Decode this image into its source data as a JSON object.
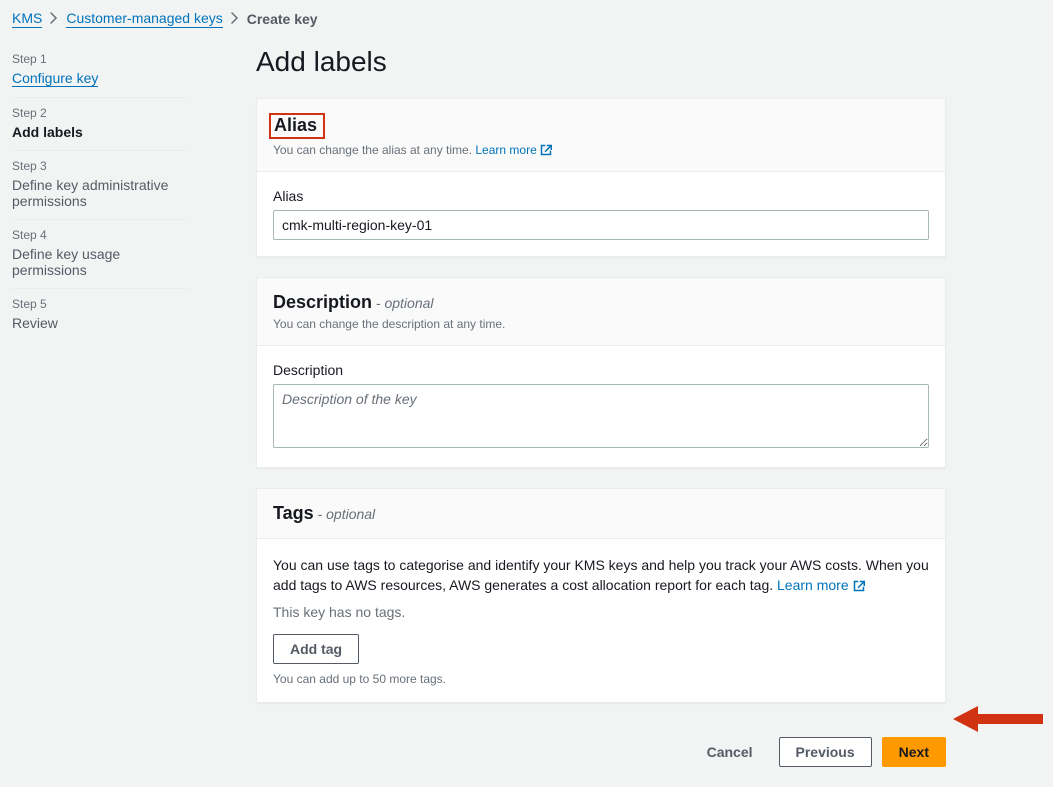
{
  "breadcrumb": {
    "root": "KMS",
    "mid": "Customer-managed keys",
    "current": "Create key"
  },
  "sidebar": {
    "steps": [
      {
        "label": "Step 1",
        "title": "Configure key",
        "kind": "link"
      },
      {
        "label": "Step 2",
        "title": "Add labels",
        "kind": "active"
      },
      {
        "label": "Step 3",
        "title": "Define key administrative permissions",
        "kind": "normal"
      },
      {
        "label": "Step 4",
        "title": "Define key usage permissions",
        "kind": "normal"
      },
      {
        "label": "Step 5",
        "title": "Review",
        "kind": "normal"
      }
    ]
  },
  "page": {
    "title": "Add labels"
  },
  "alias": {
    "heading": "Alias",
    "subtext": "You can change the alias at any time.",
    "learn": "Learn more",
    "field_label": "Alias",
    "value": "cmk-multi-region-key-01"
  },
  "description": {
    "heading": "Description",
    "optional": "- optional",
    "subtext": "You can change the description at any time.",
    "field_label": "Description",
    "placeholder": "Description of the key"
  },
  "tags": {
    "heading": "Tags",
    "optional": "- optional",
    "text": "You can use tags to categorise and identify your KMS keys and help you track your AWS costs. When you add tags to AWS resources, AWS generates a cost allocation report for each tag.",
    "learn": "Learn more",
    "empty": "This key has no tags.",
    "add_btn": "Add tag",
    "hint": "You can add up to 50 more tags."
  },
  "footer": {
    "cancel": "Cancel",
    "previous": "Previous",
    "next": "Next"
  }
}
